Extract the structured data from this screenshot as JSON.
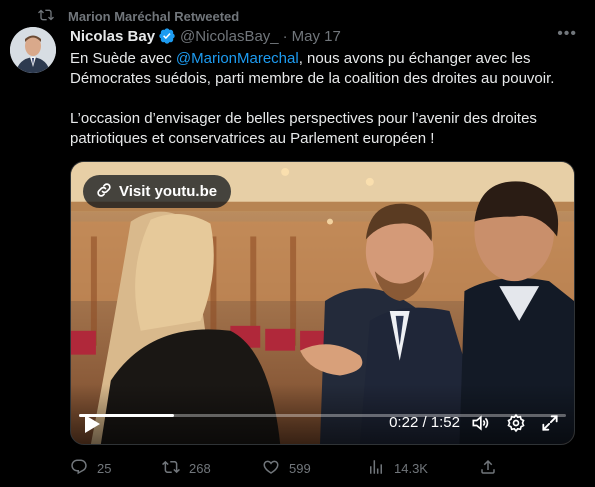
{
  "retweet": {
    "label": "Marion Maréchal Retweeted"
  },
  "tweet": {
    "author_name": "Nicolas Bay",
    "handle": "@NicolasBay_",
    "separator": "·",
    "date": "May 17",
    "more_label": "•••",
    "text_before_mention": "En Suède avec ",
    "mention": "@MarionMarechal",
    "text_after_mention": ", nous avons pu échanger avec les Démocrates suédois, parti membre de la coalition des droites au pouvoir.",
    "paragraph2": "L’occasion d’envisager de belles perspectives pour l’avenir des droites patriotiques et conservatrices au Parlement européen !"
  },
  "media": {
    "visit_label": "Visit youtu.be",
    "time": "0:22 / 1:52",
    "progress_fraction": 0.196
  },
  "actions": {
    "replies": "25",
    "retweets": "268",
    "likes": "599",
    "views": "14.3K"
  },
  "colors": {
    "accent": "#1d9bf0",
    "muted": "#71767b",
    "background": "#000000"
  },
  "icons": [
    "retweet-icon",
    "verified-badge-icon",
    "more-icon",
    "link-icon",
    "play-icon",
    "volume-icon",
    "settings-icon",
    "fullscreen-icon",
    "reply-icon",
    "like-icon",
    "views-icon",
    "share-icon"
  ]
}
